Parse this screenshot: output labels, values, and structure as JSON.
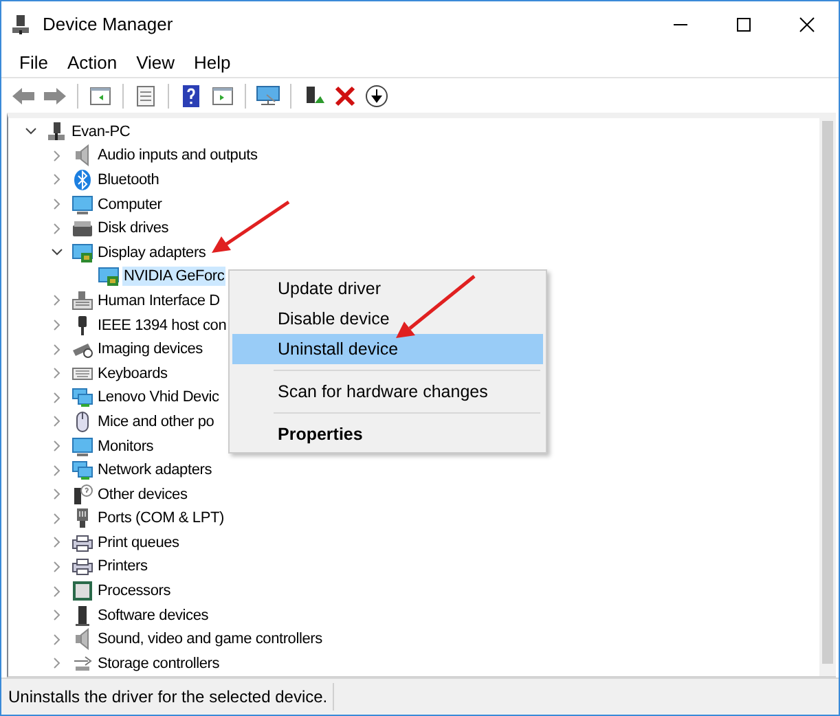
{
  "window": {
    "title": "Device Manager"
  },
  "menu_bar": [
    "File",
    "Action",
    "View",
    "Help"
  ],
  "tree": {
    "label": "Evan-PC",
    "expanded": true,
    "selected": false,
    "children": [
      {
        "label": "Audio inputs and outputs",
        "expanded": false,
        "selected": false
      },
      {
        "label": "Bluetooth",
        "expanded": false,
        "selected": false
      },
      {
        "label": "Computer",
        "expanded": false,
        "selected": false
      },
      {
        "label": "Disk drives",
        "expanded": false,
        "selected": false
      },
      {
        "label": "Display adapters",
        "expanded": true,
        "selected": false,
        "children": [
          {
            "label": "NVIDIA GeForc",
            "selected": true
          }
        ]
      },
      {
        "label": "Human Interface D",
        "expanded": false,
        "selected": false
      },
      {
        "label": "IEEE 1394 host con",
        "expanded": false,
        "selected": false
      },
      {
        "label": "Imaging devices",
        "expanded": false,
        "selected": false
      },
      {
        "label": "Keyboards",
        "expanded": false,
        "selected": false
      },
      {
        "label": "Lenovo Vhid Devic",
        "expanded": false,
        "selected": false
      },
      {
        "label": "Mice and other po",
        "expanded": false,
        "selected": false
      },
      {
        "label": "Monitors",
        "expanded": false,
        "selected": false
      },
      {
        "label": "Network adapters",
        "expanded": false,
        "selected": false
      },
      {
        "label": "Other devices",
        "expanded": false,
        "selected": false
      },
      {
        "label": "Ports (COM & LPT)",
        "expanded": false,
        "selected": false
      },
      {
        "label": "Print queues",
        "expanded": false,
        "selected": false
      },
      {
        "label": "Printers",
        "expanded": false,
        "selected": false
      },
      {
        "label": "Processors",
        "expanded": false,
        "selected": false
      },
      {
        "label": "Software devices",
        "expanded": false,
        "selected": false
      },
      {
        "label": "Sound, video and game controllers",
        "expanded": false,
        "selected": false
      },
      {
        "label": "Storage controllers",
        "expanded": false,
        "selected": false
      }
    ]
  },
  "context_menu": {
    "items": [
      {
        "kind": "item",
        "label": "Update driver",
        "selected": false,
        "default": false
      },
      {
        "kind": "item",
        "label": "Disable device",
        "selected": false,
        "default": false
      },
      {
        "kind": "item",
        "label": "Uninstall device",
        "selected": true,
        "default": false
      },
      {
        "kind": "separator"
      },
      {
        "kind": "item",
        "label": "Scan for hardware changes",
        "selected": false,
        "default": false
      },
      {
        "kind": "separator"
      },
      {
        "kind": "item",
        "label": "Properties",
        "selected": false,
        "default": true
      }
    ]
  },
  "status_bar": {
    "text": "Uninstalls the driver for the selected device."
  }
}
